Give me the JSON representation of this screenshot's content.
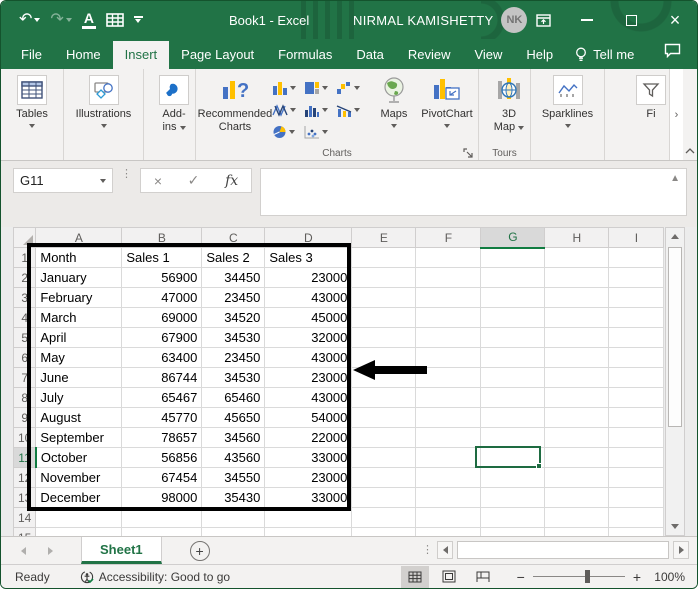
{
  "window": {
    "title": "Book1  -  Excel",
    "user_name": "NIRMAL KAMISHETTY",
    "user_initials": "NK"
  },
  "tabs": {
    "items": [
      "File",
      "Home",
      "Insert",
      "Page Layout",
      "Formulas",
      "Data",
      "Review",
      "View",
      "Help"
    ],
    "active": "Insert",
    "tell_me": "Tell me"
  },
  "ribbon": {
    "tables_label": "Tables",
    "illustrations_label": "Illustrations",
    "addins_line1": "Add-",
    "addins_line2": "ins",
    "recommended_line1": "Recommended",
    "recommended_line2": "Charts",
    "maps_label": "Maps",
    "pivotchart_label": "PivotChart",
    "charts_group_label": "Charts",
    "map3d_line1": "3D",
    "map3d_line2": "Map",
    "tours_group_label": "Tours",
    "sparklines_label": "Sparklines",
    "filters_label_truncated": "Fi",
    "scroll_more": "›"
  },
  "formula_bar": {
    "name_box": "G11",
    "cancel": "×",
    "enter": "✓",
    "fx": "fx"
  },
  "sheet": {
    "columns": [
      "A",
      "B",
      "C",
      "D",
      "E",
      "F",
      "G",
      "H",
      "I"
    ],
    "row_count": 15,
    "selected_cell": "G11",
    "selected_column": "G",
    "selected_row": 11,
    "table": {
      "headers": [
        "Month",
        "Sales 1",
        "Sales 2",
        "Sales 3"
      ],
      "rows": [
        [
          "January",
          "56900",
          "34450",
          "23000"
        ],
        [
          "February",
          "47000",
          "23450",
          "43000"
        ],
        [
          "March",
          "69000",
          "34520",
          "45000"
        ],
        [
          "April",
          "67900",
          "34530",
          "32000"
        ],
        [
          "May",
          "63400",
          "23450",
          "43000"
        ],
        [
          "June",
          "86744",
          "34530",
          "23000"
        ],
        [
          "July",
          "65467",
          "65460",
          "43000"
        ],
        [
          "August",
          "45770",
          "45650",
          "54000"
        ],
        [
          "September",
          "78657",
          "34560",
          "22000"
        ],
        [
          "October",
          "56856",
          "43560",
          "33000"
        ],
        [
          "November",
          "67454",
          "34550",
          "23000"
        ],
        [
          "December",
          "98000",
          "35430",
          "33000"
        ]
      ]
    }
  },
  "sheet_tabs": {
    "active": "Sheet1",
    "add_label": "+"
  },
  "status_bar": {
    "ready": "Ready",
    "accessibility": "Accessibility: Good to go",
    "zoom_level": "100%"
  },
  "colors": {
    "excel_green": "#217346",
    "chart_blue": "#4472c4",
    "chart_yellow": "#ffc000",
    "selection_green": "#1e6b41"
  }
}
